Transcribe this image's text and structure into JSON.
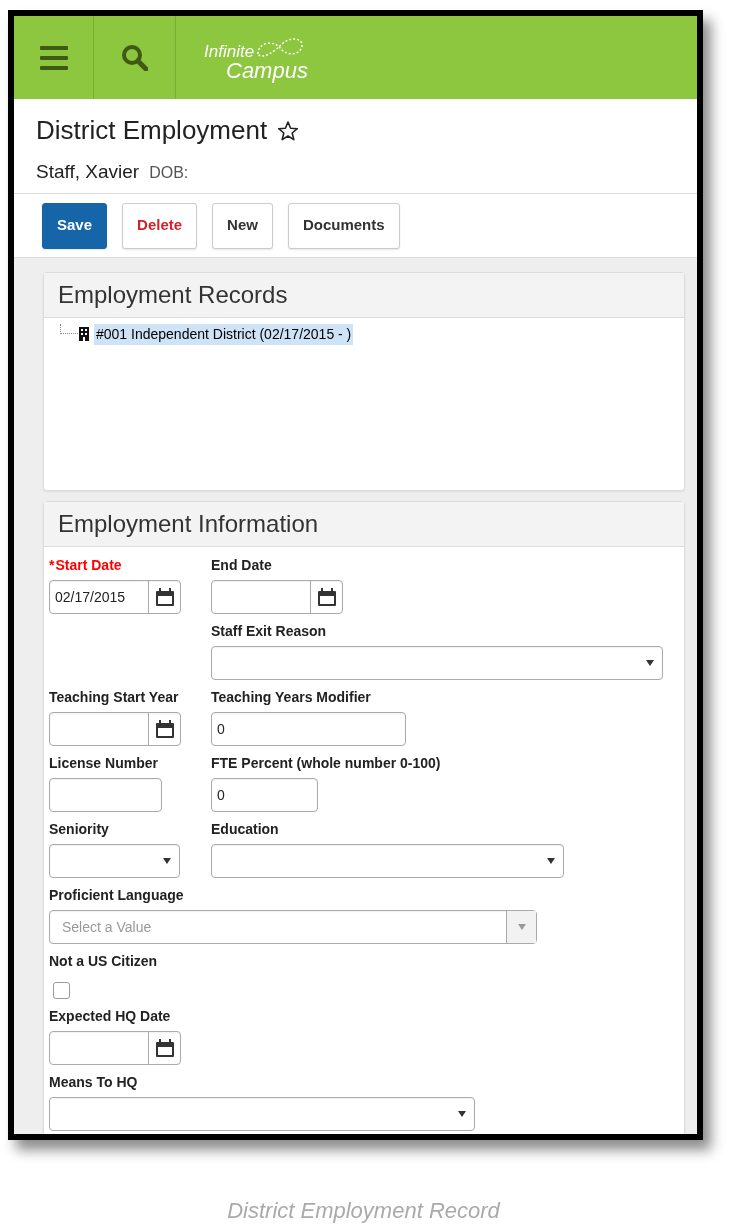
{
  "header": {
    "logo": {
      "line1": "Infinite",
      "line2": "Campus"
    }
  },
  "page": {
    "title": "District Employment",
    "favorite": false,
    "person": "Staff, Xavier",
    "dob_label": "DOB:"
  },
  "toolbar": [
    {
      "label": "Save",
      "kind": "primary"
    },
    {
      "label": "Delete",
      "kind": "danger"
    },
    {
      "label": "New",
      "kind": "default"
    },
    {
      "label": "Documents",
      "kind": "default"
    }
  ],
  "records_panel": {
    "title": "Employment Records",
    "tree": [
      {
        "label": "#001 Independent District (02/17/2015 - )",
        "selected": true
      }
    ]
  },
  "info_panel": {
    "title": "Employment Information",
    "required_marker": "*",
    "rows": [
      {
        "fields": [
          {
            "label": "Start Date",
            "kind": "date",
            "required": true,
            "value": "02/17/2015"
          },
          {
            "label": "End Date",
            "kind": "date",
            "required": false
          }
        ]
      },
      {
        "fields": [
          {
            "label": "Staff Exit Reason",
            "kind": "select",
            "required": false
          }
        ]
      },
      {
        "fields": [
          {
            "label": "Teaching Start Year",
            "kind": "date",
            "required": false
          },
          {
            "label": "Teaching Years Modifier",
            "kind": "text",
            "required": false,
            "value": "0"
          }
        ]
      },
      {
        "fields": [
          {
            "label": "License Number",
            "kind": "text",
            "required": false
          },
          {
            "label": "FTE Percent (whole number 0-100)",
            "kind": "text",
            "required": false,
            "value": "0"
          }
        ]
      },
      {
        "fields": [
          {
            "label": "Seniority",
            "kind": "select",
            "required": false
          },
          {
            "label": "Education",
            "kind": "select",
            "required": false
          }
        ]
      },
      {
        "fields": [
          {
            "label": "Proficient Language",
            "kind": "combo",
            "required": false,
            "placeholder": "Select a Value"
          }
        ]
      },
      {
        "fields": [
          {
            "label": "Not a US Citizen",
            "kind": "checkbox",
            "required": false,
            "checked": false
          }
        ]
      },
      {
        "fields": [
          {
            "label": "Expected HQ Date",
            "kind": "date",
            "required": false
          }
        ]
      },
      {
        "fields": [
          {
            "label": "Means To HQ",
            "kind": "select",
            "required": false
          }
        ]
      }
    ]
  },
  "caption": "District Employment Record"
}
